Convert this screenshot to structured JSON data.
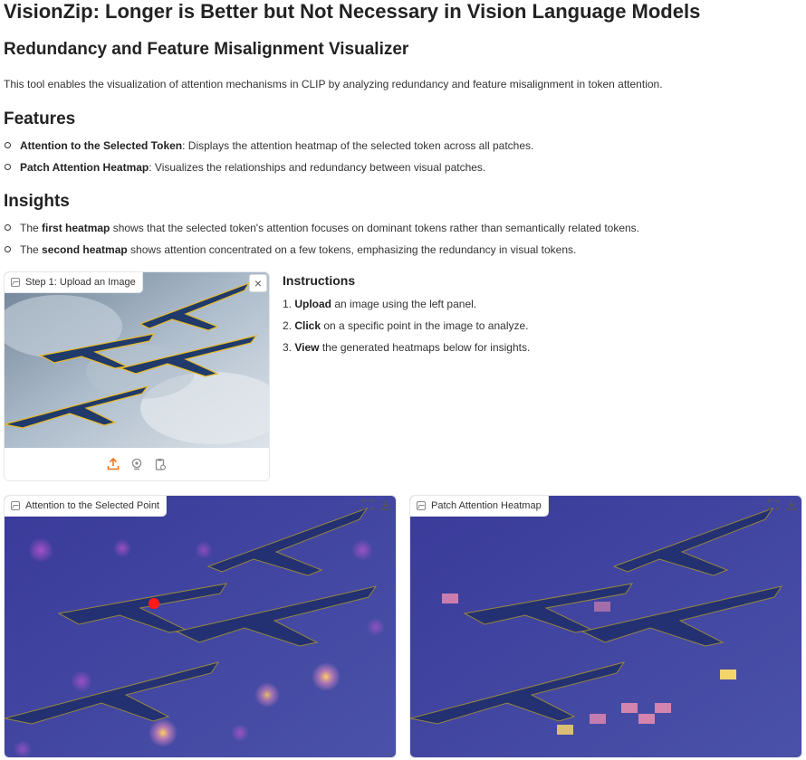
{
  "title": "VisionZip: Longer is Better but Not Necessary in Vision Language Models",
  "subtitle": "Redundancy and Feature Misalignment Visualizer",
  "description": "This tool enables the visualization of attention mechanisms in CLIP by analyzing redundancy and feature misalignment in token attention.",
  "features": {
    "heading": "Features",
    "items": [
      {
        "bold": "Attention to the Selected Token",
        "rest": ": Displays the attention heatmap of the selected token across all patches."
      },
      {
        "bold": "Patch Attention Heatmap",
        "rest": ": Visualizes the relationships and redundancy between visual patches."
      }
    ]
  },
  "insights": {
    "heading": "Insights",
    "items": [
      {
        "pre": "The ",
        "bold": "first heatmap",
        "rest": " shows that the selected token's attention focuses on dominant tokens rather than semantically related tokens."
      },
      {
        "pre": "The ",
        "bold": "second heatmap",
        "rest": " shows attention concentrated on a few tokens, emphasizing the redundancy in visual tokens."
      }
    ]
  },
  "upload_panel": {
    "label": "Step 1: Upload an Image",
    "close_symbol": "×",
    "icons": [
      "upload-icon",
      "webcam-icon",
      "clipboard-icon"
    ],
    "accent_color": "#f97316"
  },
  "instructions": {
    "heading": "Instructions",
    "steps": [
      {
        "num": "1. ",
        "bold": "Upload",
        "rest": " an image using the left panel."
      },
      {
        "num": "2. ",
        "bold": "Click",
        "rest": " on a specific point in the image to analyze."
      },
      {
        "num": "3. ",
        "bold": "View",
        "rest": " the generated heatmaps below for insights."
      }
    ]
  },
  "output_panels": [
    {
      "label": "Attention to the Selected Point",
      "icons": [
        "fullscreen-icon",
        "download-icon"
      ]
    },
    {
      "label": "Patch Attention Heatmap",
      "icons": [
        "fullscreen-icon",
        "download-icon"
      ]
    }
  ],
  "colors": {
    "overlay_purple": "#2c2a8a",
    "selected_point": "#ff1a1a",
    "hot_patch": "#f3d46b",
    "warm_patch": "#e48ab0"
  }
}
